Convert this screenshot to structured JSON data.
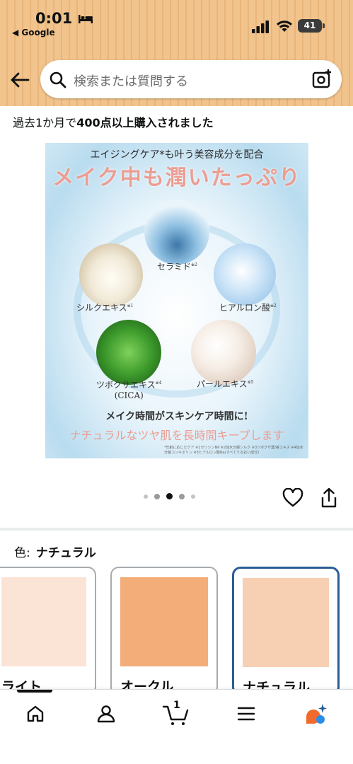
{
  "status_bar": {
    "time": "0:01",
    "back_app": "◀ Google",
    "battery": "41"
  },
  "search": {
    "placeholder": "検索または質問する"
  },
  "purchase_info": {
    "prefix": "過去1か月で",
    "highlight": "400点以上購入されました"
  },
  "product_image": {
    "top_text": "エイジングケア*も叶う美容成分を配合",
    "title": "メイク中も潤いたっぷり",
    "ingredients": [
      {
        "name": "セラミド",
        "sup": "※2"
      },
      {
        "name": "ヒアルロン酸",
        "sup": "※2"
      },
      {
        "name": "シルクエキス",
        "sup": "※1"
      },
      {
        "name": "ツボクサエキス",
        "sup": "※4"
      },
      {
        "name": "(CICA)",
        "sup": ""
      },
      {
        "name": "パールエキス",
        "sup": "※5"
      }
    ],
    "bottom_line1": "メイク時間がスキンケア時間に!",
    "bottom_line2": "ナチュラルなツヤ肌を長時間キープします",
    "footnote": "*年齢に応じたケア ※1セリシンNP ※2加水分解シルク ※3ツボクサ葉/茎エキス ※4加水分解コンキオリン ※5ヒアルロン酸Na(すべてうるおい成分)"
  },
  "carousel": {
    "dot_count": 5,
    "active_index": 2
  },
  "color_selector": {
    "label": "色:",
    "selected": "ナチュラル",
    "options": [
      {
        "label": "ライト",
        "color": "#fbe3d5"
      },
      {
        "label": "オークル",
        "color": "#f2ad79"
      },
      {
        "label": "ナチュラル",
        "color": "#f7cfb3"
      }
    ]
  },
  "colors": {
    "header_bg": "#f2c48d",
    "accent_blue": "#2a5d93",
    "hero_pink": "#ec9d92"
  },
  "bottom_nav": {
    "items": [
      "home-icon",
      "account-icon",
      "cart-icon",
      "menu-icon",
      "ai-assistant-icon"
    ],
    "cart_count": "1"
  }
}
